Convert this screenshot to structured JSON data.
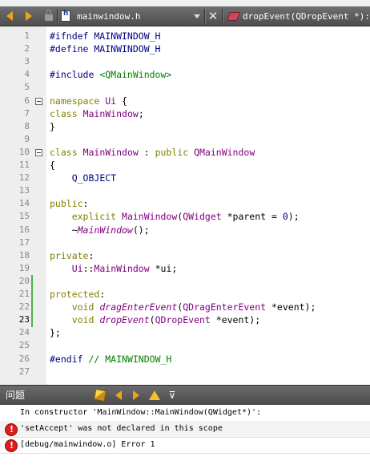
{
  "colors": {
    "keyword": "#808000",
    "type": "#800080",
    "preproc": "#000080",
    "comment": "#008000",
    "error": "#e01c1c"
  },
  "editor_toolbar": {
    "icons": [
      "back-arrow-icon",
      "forward-arrow-icon",
      "lock-icon",
      "header-file-icon",
      "close-icon",
      "function-icon"
    ],
    "file_name": "mainwindow.h",
    "function_selector": "dropEvent(QDropEvent *): vo"
  },
  "lines": [
    {
      "n": "1",
      "parts": [
        {
          "c": "p",
          "t": "#ifndef MAINWINDOW_H"
        }
      ]
    },
    {
      "n": "2",
      "parts": [
        {
          "c": "p",
          "t": "#define MAINWINDOW_H"
        }
      ]
    },
    {
      "n": "3",
      "parts": []
    },
    {
      "n": "4",
      "parts": [
        {
          "c": "p",
          "t": "#include "
        },
        {
          "c": "s",
          "t": "<QMainWindow>"
        }
      ]
    },
    {
      "n": "5",
      "parts": []
    },
    {
      "n": "6",
      "fold": true,
      "parts": [
        {
          "c": "k",
          "t": "namespace"
        },
        {
          "c": "",
          "t": " "
        },
        {
          "c": "t",
          "t": "Ui"
        },
        {
          "c": "",
          "t": " {"
        }
      ]
    },
    {
      "n": "7",
      "parts": [
        {
          "c": "k",
          "t": "class"
        },
        {
          "c": "",
          "t": " "
        },
        {
          "c": "t",
          "t": "MainWindow"
        },
        {
          "c": "",
          "t": ";"
        }
      ]
    },
    {
      "n": "8",
      "parts": [
        {
          "c": "",
          "t": "}"
        }
      ]
    },
    {
      "n": "9",
      "parts": []
    },
    {
      "n": "10",
      "fold": true,
      "parts": [
        {
          "c": "k",
          "t": "class"
        },
        {
          "c": "",
          "t": " "
        },
        {
          "c": "t",
          "t": "MainWindow"
        },
        {
          "c": "",
          "t": " : "
        },
        {
          "c": "k",
          "t": "public"
        },
        {
          "c": "",
          "t": " "
        },
        {
          "c": "t",
          "t": "QMainWindow"
        }
      ]
    },
    {
      "n": "11",
      "parts": [
        {
          "c": "",
          "t": "{"
        }
      ]
    },
    {
      "n": "12",
      "parts": [
        {
          "c": "",
          "t": "    "
        },
        {
          "c": "n",
          "t": "Q_OBJECT"
        }
      ]
    },
    {
      "n": "13",
      "parts": []
    },
    {
      "n": "14",
      "parts": [
        {
          "c": "k",
          "t": "public"
        },
        {
          "c": "",
          "t": ":"
        }
      ]
    },
    {
      "n": "15",
      "parts": [
        {
          "c": "",
          "t": "    "
        },
        {
          "c": "k",
          "t": "explicit"
        },
        {
          "c": "",
          "t": " "
        },
        {
          "c": "t",
          "t": "MainWindow"
        },
        {
          "c": "",
          "t": "("
        },
        {
          "c": "t",
          "t": "QWidget"
        },
        {
          "c": "",
          "t": " *parent = "
        },
        {
          "c": "n",
          "t": "0"
        },
        {
          "c": "",
          "t": ");"
        }
      ]
    },
    {
      "n": "16",
      "parts": [
        {
          "c": "",
          "t": "    ~"
        },
        {
          "c": "i",
          "t": "MainWindow"
        },
        {
          "c": "",
          "t": "();"
        }
      ]
    },
    {
      "n": "17",
      "parts": []
    },
    {
      "n": "18",
      "parts": [
        {
          "c": "k",
          "t": "private"
        },
        {
          "c": "",
          "t": ":"
        }
      ]
    },
    {
      "n": "19",
      "parts": [
        {
          "c": "",
          "t": "    "
        },
        {
          "c": "t",
          "t": "Ui"
        },
        {
          "c": "",
          "t": "::"
        },
        {
          "c": "t",
          "t": "MainWindow"
        },
        {
          "c": "",
          "t": " *ui;"
        }
      ]
    },
    {
      "n": "20",
      "changed": true,
      "parts": []
    },
    {
      "n": "21",
      "changed": true,
      "parts": [
        {
          "c": "k",
          "t": "protected"
        },
        {
          "c": "",
          "t": ":"
        }
      ]
    },
    {
      "n": "22",
      "changed": true,
      "parts": [
        {
          "c": "",
          "t": "    "
        },
        {
          "c": "k",
          "t": "void"
        },
        {
          "c": "",
          "t": " "
        },
        {
          "c": "i",
          "t": "dragEnterEvent"
        },
        {
          "c": "",
          "t": "("
        },
        {
          "c": "t",
          "t": "QDragEnterEvent"
        },
        {
          "c": "",
          "t": " *event);"
        }
      ]
    },
    {
      "n": "23",
      "changed": true,
      "current": true,
      "parts": [
        {
          "c": "",
          "t": "    "
        },
        {
          "c": "k",
          "t": "void"
        },
        {
          "c": "",
          "t": " "
        },
        {
          "c": "i",
          "t": "dropEvent"
        },
        {
          "c": "",
          "t": "("
        },
        {
          "c": "t",
          "t": "QDropEvent"
        },
        {
          "c": "",
          "t": " *event);"
        }
      ]
    },
    {
      "n": "24",
      "parts": [
        {
          "c": "",
          "t": "};"
        }
      ]
    },
    {
      "n": "25",
      "parts": []
    },
    {
      "n": "26",
      "parts": [
        {
          "c": "p",
          "t": "#endif"
        },
        {
          "c": "",
          "t": " "
        },
        {
          "c": "s",
          "t": "// MAINWINDOW_H"
        }
      ]
    },
    {
      "n": "27",
      "parts": []
    }
  ],
  "issues": {
    "title": "问题",
    "header_icons": [
      "clear-icon",
      "prev-icon",
      "next-icon",
      "warning-filter-icon",
      "filter-icon"
    ],
    "rows": [
      {
        "icon": "",
        "text": "In constructor 'MainWindow::MainWindow(QWidget*)':"
      },
      {
        "icon": "error-icon",
        "text": "'setAccept' was not declared in this scope"
      },
      {
        "icon": "error-icon",
        "text": "[debug/mainwindow.o] Error 1"
      }
    ]
  }
}
